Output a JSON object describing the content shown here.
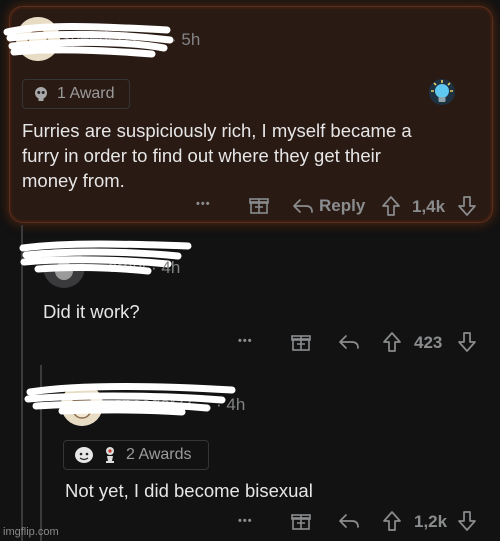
{
  "comments": [
    {
      "username": "speederzz",
      "time": "· 5h",
      "award_label": "1 Award",
      "body_lines": [
        "Furries are suspiciously rich, I myself became a",
        "furry in order to find out where they get their",
        "money from."
      ],
      "more": "•••",
      "reply_label": "Reply",
      "votes": "1,4k"
    },
    {
      "username": "ornol",
      "time": "· 4h",
      "body": "Did it work?",
      "more": "•••",
      "votes": "423"
    },
    {
      "username": "speederzz",
      "time": "· 4h",
      "award_label": "2 Awards",
      "body": "Not yet, I did become bisexual",
      "more": "•••",
      "votes": "1,2k"
    }
  ],
  "watermark": "imgflip.com",
  "colors": {
    "background": "#121212",
    "highlight": "#2a1a14",
    "highlight_border": "#5a3020",
    "text": "#e6e6e6",
    "muted": "#818384"
  },
  "icons": [
    "gift-icon",
    "reply-arrow-icon",
    "upvote-icon",
    "downvote-icon",
    "lightbulb-icon",
    "skull-award-icon"
  ]
}
